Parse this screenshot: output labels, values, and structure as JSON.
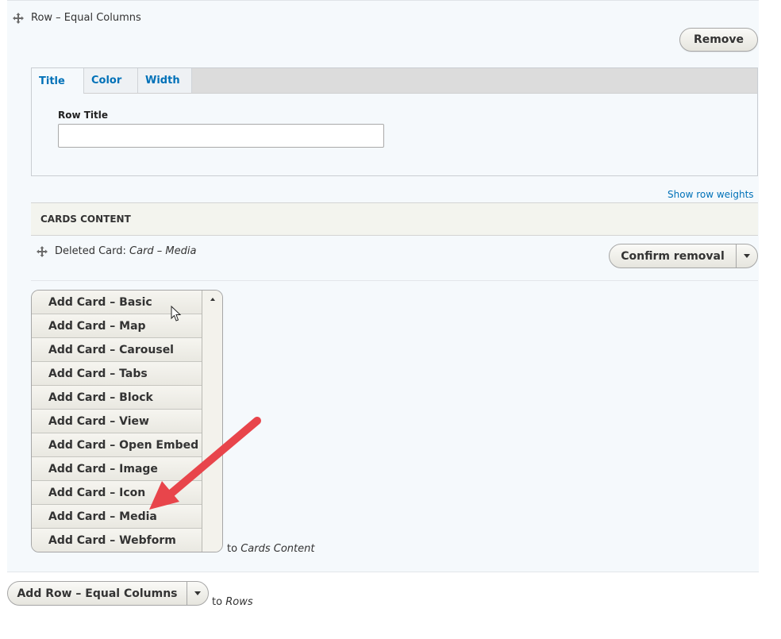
{
  "row": {
    "label": "Row – Equal Columns",
    "remove_button": "Remove"
  },
  "tabs": [
    {
      "label": "Title"
    },
    {
      "label": "Color"
    },
    {
      "label": "Width"
    }
  ],
  "title_field": {
    "label": "Row Title",
    "value": ""
  },
  "show_row_weights": "Show row weights",
  "cards_content": {
    "header": "CARDS CONTENT",
    "deleted_prefix": "Deleted Card:",
    "deleted_name": "Card – Media",
    "confirm_button": "Confirm removal"
  },
  "add_card_menu": {
    "items": [
      "Add Card – Basic",
      "Add Card – Map",
      "Add Card – Carousel",
      "Add Card – Tabs",
      "Add Card – Block",
      "Add Card – View",
      "Add Card – Open Embed",
      "Add Card – Image",
      "Add Card – Icon",
      "Add Card – Media",
      "Add Card – Webform"
    ],
    "suffix_to": "to",
    "suffix_target": "Cards Content"
  },
  "add_row": {
    "button": "Add Row – Equal Columns",
    "suffix_to": "to",
    "suffix_target": "Rows"
  },
  "colors": {
    "link": "#0071b8",
    "arrow": "#e8454b",
    "panel": "#f5f9fc"
  },
  "icons": {
    "drag": "four-way-arrow",
    "dropdown": "caret-down",
    "scroll_up": "caret-up",
    "cursor": "mouse-pointer",
    "annotation": "red-arrow"
  }
}
